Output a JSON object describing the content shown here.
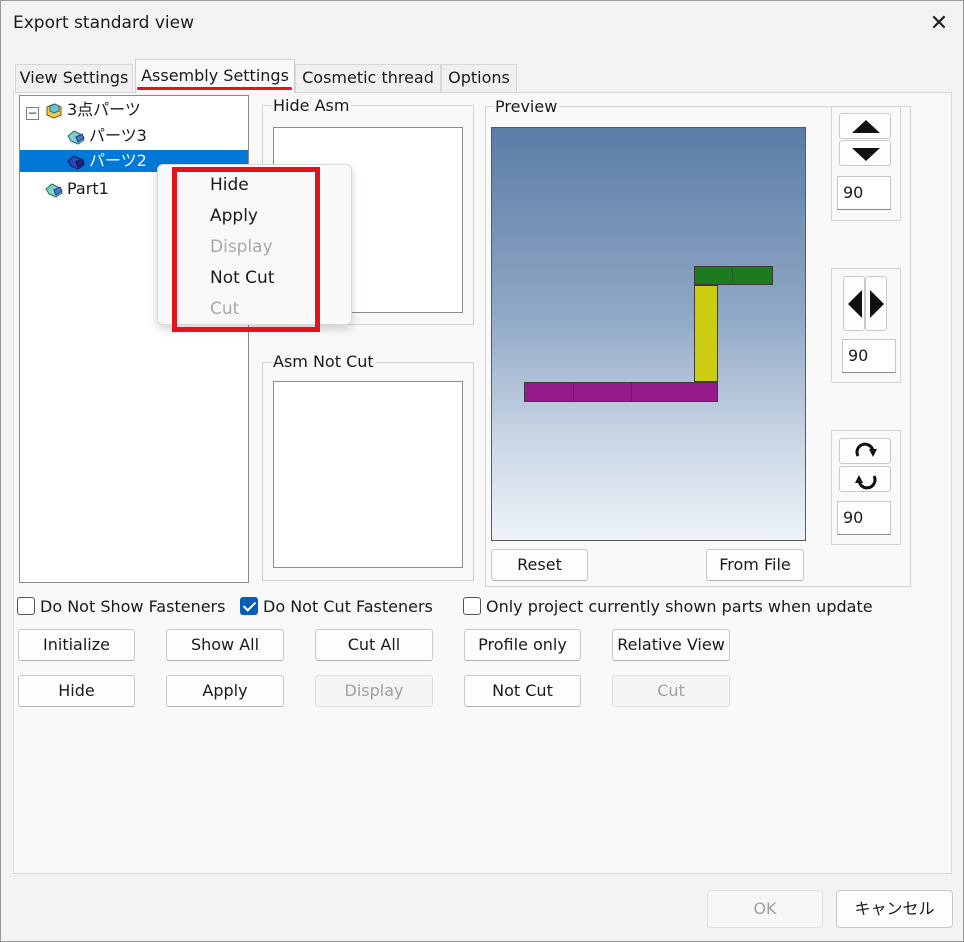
{
  "window": {
    "title": "Export standard view"
  },
  "tabs": [
    {
      "label": "View Settings"
    },
    {
      "label": "Assembly Settings"
    },
    {
      "label": "Cosmetic thread"
    },
    {
      "label": "Options"
    }
  ],
  "tree": {
    "items": [
      {
        "label": "3点パーツ"
      },
      {
        "label": "パーツ3"
      },
      {
        "label": "パーツ2"
      },
      {
        "label": "Part1"
      }
    ]
  },
  "groups": {
    "hide_asm": "Hide Asm",
    "asm_not_cut": "Asm Not Cut",
    "preview": "Preview"
  },
  "preview_controls": {
    "vertical_angle": "90",
    "horizontal_angle": "90",
    "rotate_angle": "90",
    "reset_label": "Reset",
    "from_file_label": "From File"
  },
  "checkboxes": [
    {
      "label": "Do Not Show Fasteners",
      "checked": false
    },
    {
      "label": "Do Not Cut Fasteners",
      "checked": true
    },
    {
      "label": "Only project currently shown parts when update",
      "checked": false
    }
  ],
  "buttons_row1": [
    "Initialize",
    "Show All",
    "Cut All",
    "Profile only",
    "Relative View"
  ],
  "buttons_row2": [
    "Hide",
    "Apply",
    "Display",
    "Not Cut",
    "Cut"
  ],
  "context_menu": [
    {
      "label": "Hide",
      "enabled": true
    },
    {
      "label": "Apply",
      "enabled": true
    },
    {
      "label": "Display",
      "enabled": false
    },
    {
      "label": "Not Cut",
      "enabled": true
    },
    {
      "label": "Cut",
      "enabled": false
    }
  ],
  "footer": {
    "ok_label": "OK",
    "cancel_label": "キャンセル"
  },
  "colors": {
    "accent_red": "#e1141e",
    "selection_blue": "#0078d7",
    "part_green": "#1e7a1e",
    "part_yellow": "#cccc12",
    "part_magenta": "#951b8c"
  }
}
